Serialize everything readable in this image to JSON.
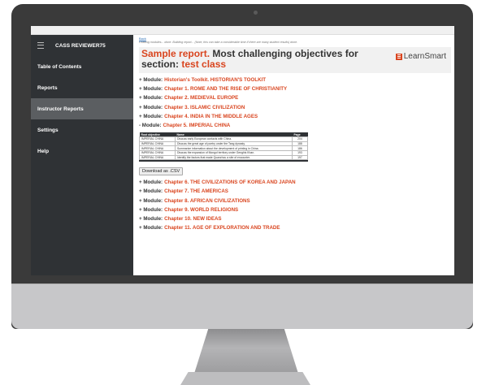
{
  "sidebar": {
    "title": "CASS REVIEWER75",
    "items": [
      {
        "label": "Table of Contents",
        "active": false
      },
      {
        "label": "Reports",
        "active": false
      },
      {
        "label": "Instructor Reports",
        "active": true
      },
      {
        "label": "Settings",
        "active": false
      },
      {
        "label": "Help",
        "active": false
      }
    ]
  },
  "main": {
    "back_link": "Back",
    "status": "Loading modules... done. Building report... (Note, this can take a considerable time if there are many student results) done.",
    "report_title_red": "Sample report.",
    "report_title_dark": " Most challenging objectives for section: ",
    "report_section": "test class",
    "logo_text": "LearnSmart",
    "module_prefix": "Module:",
    "modules_before": [
      {
        "sign": "+",
        "name": "Historian's Toolkit. HISTORIAN'S TOOLKIT"
      },
      {
        "sign": "+",
        "name": "Chapter 1. ROME AND THE RISE OF CHRISTIANITY"
      },
      {
        "sign": "+",
        "name": "Chapter 2. MEDIEVAL EUROPE"
      },
      {
        "sign": "+",
        "name": "Chapter 3. ISLAMIC CIVILIZATION"
      },
      {
        "sign": "+",
        "name": "Chapter 4. INDIA IN THE MIDDLE AGES"
      },
      {
        "sign": "-",
        "name": "Chapter 5. IMPERIAL CHINA"
      }
    ],
    "table": {
      "headers": [
        "Root objective",
        "Name",
        "Page"
      ],
      "rows": [
        [
          "IMPERIAL CHINA",
          "Discuss early European contacts with China.",
          "204"
        ],
        [
          "IMPERIAL CHINA",
          "Discuss the great age of poetry under the Tang dynasty.",
          "188"
        ],
        [
          "IMPERIAL CHINA",
          "Summarize information about the development of printing in China.",
          "186"
        ],
        [
          "IMPERIAL CHINA",
          "Discuss the expansion of Mongol territory under Genghis Khan.",
          "193"
        ],
        [
          "IMPERIAL CHINA",
          "Identify the factors that made Quanzhou a site of encounter.",
          "197"
        ]
      ]
    },
    "csv_button": "Download as .CSV",
    "modules_after": [
      {
        "sign": "+",
        "name": "Chapter 6. THE CIVILIZATIONS OF KOREA AND JAPAN"
      },
      {
        "sign": "+",
        "name": "Chapter 7. THE AMERICAS"
      },
      {
        "sign": "+",
        "name": "Chapter 8. AFRICAN CIVILIZATIONS"
      },
      {
        "sign": "+",
        "name": "Chapter 9. WORLD RELIGIONS"
      },
      {
        "sign": "+",
        "name": "Chapter 10. NEW IDEAS"
      },
      {
        "sign": "+",
        "name": "Chapter 11. AGE OF EXPLORATION AND TRADE"
      }
    ]
  },
  "colors": {
    "accent": "#d9451f",
    "sidebar": "#2f3235",
    "sidebar_active": "#5b5e61"
  },
  "icons": {
    "menu": "hamburger-icon",
    "logo": "learnsmart-logo-icon"
  }
}
